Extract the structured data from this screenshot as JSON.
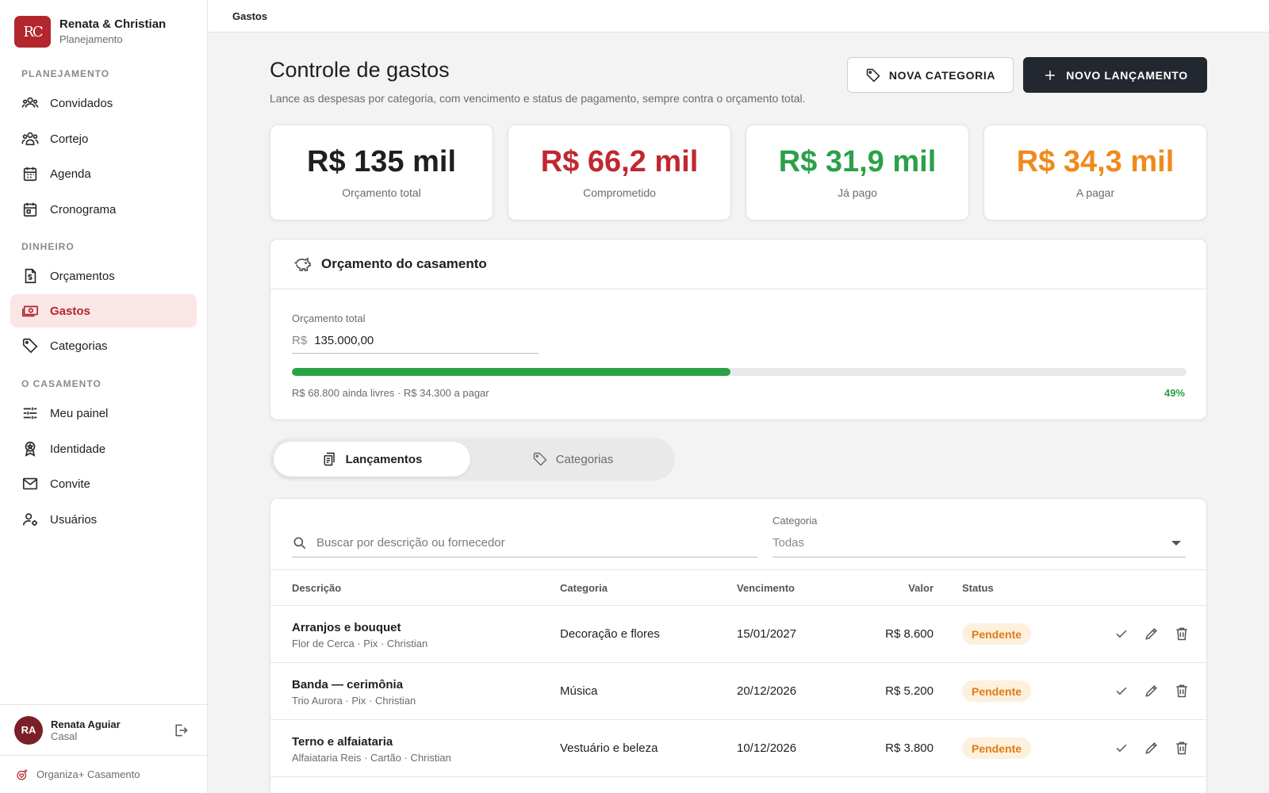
{
  "brand": {
    "logo": "RC",
    "name": "Renata & Christian",
    "subtitle": "Planejamento"
  },
  "nav": {
    "sections": [
      "PLANEJAMENTO",
      "DINHEIRO",
      "O CASAMENTO"
    ],
    "items": [
      {
        "label": "Convidados",
        "icon": "guests-icon"
      },
      {
        "label": "Cortejo",
        "icon": "group-icon"
      },
      {
        "label": "Agenda",
        "icon": "calendar-icon"
      },
      {
        "label": "Cronograma",
        "icon": "schedule-icon"
      },
      {
        "label": "Orçamentos",
        "icon": "quote-document-icon"
      },
      {
        "label": "Gastos",
        "icon": "money-icon",
        "active": true
      },
      {
        "label": "Categorias",
        "icon": "tag-icon"
      },
      {
        "label": "Meu painel",
        "icon": "sliders-icon"
      },
      {
        "label": "Identidade",
        "icon": "badge-icon"
      },
      {
        "label": "Convite",
        "icon": "mail-icon"
      },
      {
        "label": "Usuários",
        "icon": "user-settings-icon"
      }
    ]
  },
  "user": {
    "initials": "RA",
    "name": "Renata Aguiar",
    "role": "Casal"
  },
  "footer": {
    "product": "Organiza+ Casamento"
  },
  "topbar": {
    "breadcrumb": "Gastos"
  },
  "header": {
    "title": "Controle de gastos",
    "description": "Lance as despesas por categoria, com vencimento e status de pagamento, sempre contra o orçamento total.",
    "new_category": "NOVA CATEGORIA",
    "new_entry": "NOVO LANÇAMENTO"
  },
  "stats": [
    {
      "value": "R$ 135 mil",
      "label": "Orçamento total",
      "color": "#1f1f1f"
    },
    {
      "value": "R$ 66,2 mil",
      "label": "Comprometido",
      "color": "#c0282f"
    },
    {
      "value": "R$ 31,9 mil",
      "label": "Já pago",
      "color": "#2aa147"
    },
    {
      "value": "R$ 34,3 mil",
      "label": "A pagar",
      "color": "#f08a1c"
    }
  ],
  "budget": {
    "title": "Orçamento do casamento",
    "field_label": "Orçamento total",
    "currency": "R$",
    "value": "135.000,00",
    "progress_fraction": 0.49,
    "note": "R$ 68.800 ainda livres · R$ 34.300 a pagar",
    "percent_label": "49%"
  },
  "tabs": [
    {
      "label": "Lançamentos",
      "active": true
    },
    {
      "label": "Categorias",
      "active": false
    }
  ],
  "filters": {
    "search_placeholder": "Buscar por descrição ou fornecedor",
    "category_label": "Categoria",
    "category_value": "Todas"
  },
  "table": {
    "columns": [
      "Descrição",
      "Categoria",
      "Vencimento",
      "Valor",
      "Status"
    ],
    "rows": [
      {
        "title": "Arranjos e bouquet",
        "meta": "Flor de Cerca · Pix · Christian",
        "category": "Decoração e flores",
        "due": "15/01/2027",
        "value": "R$ 8.600",
        "status": "Pendente"
      },
      {
        "title": "Banda — cerimônia",
        "meta": "Trio Aurora · Pix · Christian",
        "category": "Música",
        "due": "20/12/2026",
        "value": "R$ 5.200",
        "status": "Pendente"
      },
      {
        "title": "Terno e alfaiataria",
        "meta": "Alfaiataria Reis · Cartão · Christian",
        "category": "Vestuário e beleza",
        "due": "10/12/2026",
        "value": "R$ 3.800",
        "status": "Pendente"
      }
    ]
  }
}
